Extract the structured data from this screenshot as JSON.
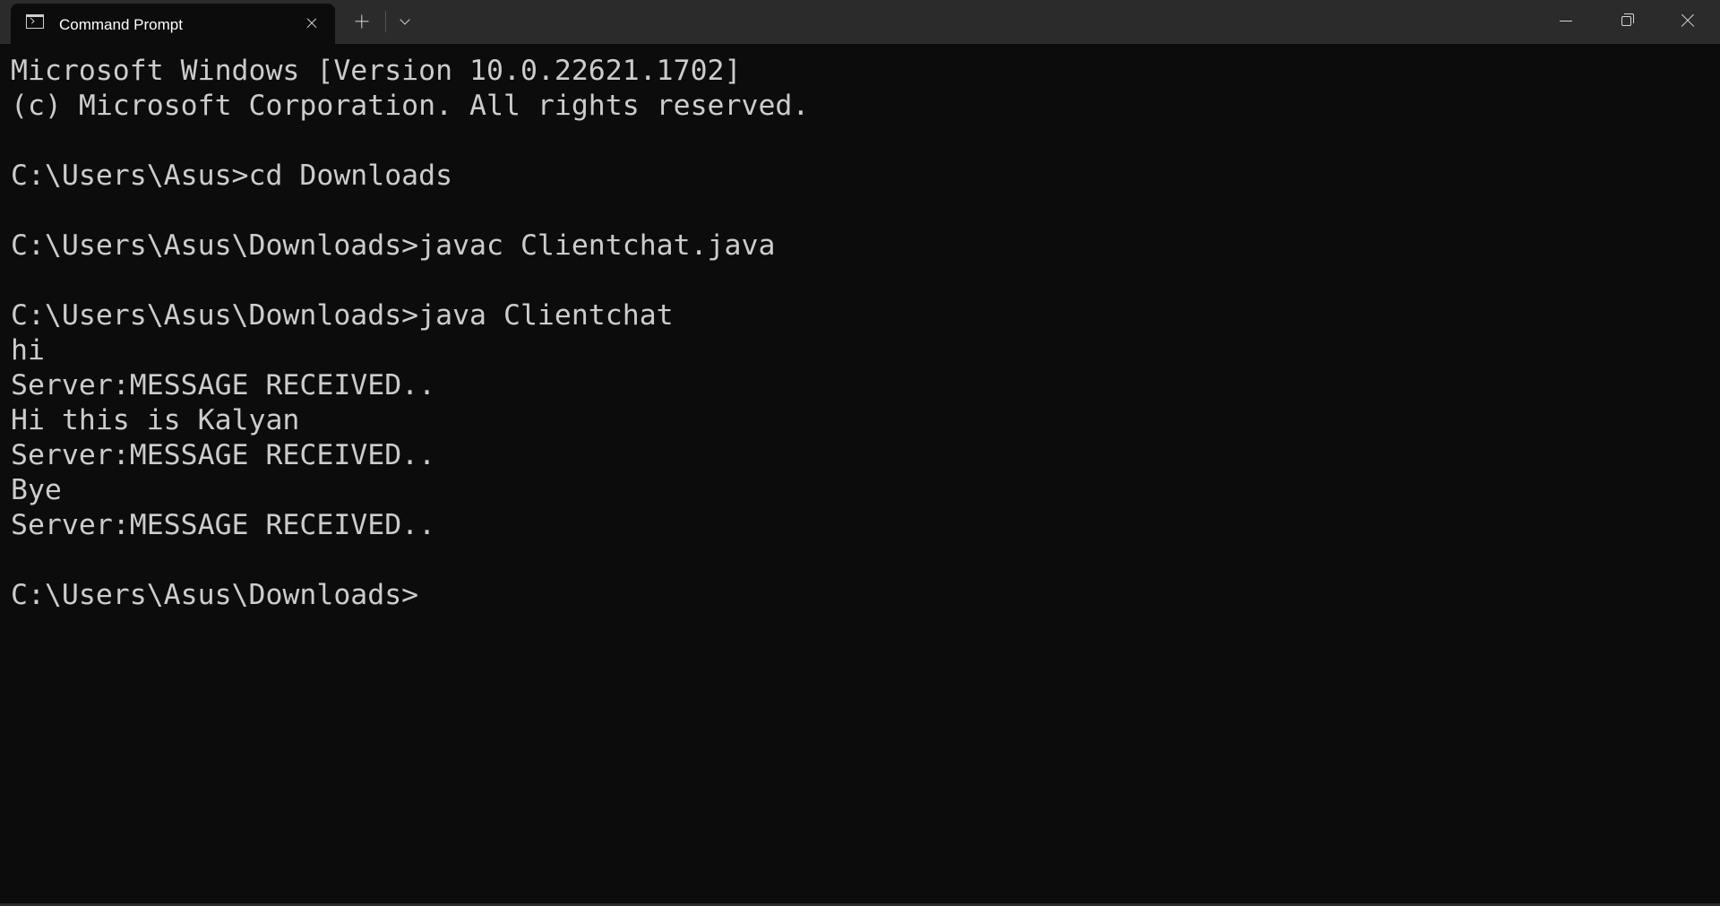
{
  "titlebar": {
    "tab_title": "Command Prompt",
    "tab_icon": "terminal-icon",
    "close_tab_icon": "close-icon",
    "new_tab_icon": "plus-icon",
    "dropdown_icon": "chevron-down-icon"
  },
  "window_controls": {
    "minimize_icon": "minimize-icon",
    "maximize_icon": "restore-icon",
    "close_icon": "close-icon"
  },
  "console": {
    "lines": [
      "Microsoft Windows [Version 10.0.22621.1702]",
      "(c) Microsoft Corporation. All rights reserved.",
      "",
      "C:\\Users\\Asus>cd Downloads",
      "",
      "C:\\Users\\Asus\\Downloads>javac Clientchat.java",
      "",
      "C:\\Users\\Asus\\Downloads>java Clientchat",
      "hi",
      "Server:MESSAGE RECEIVED..",
      "Hi this is Kalyan",
      "Server:MESSAGE RECEIVED..",
      "Bye",
      "Server:MESSAGE RECEIVED..",
      "",
      "C:\\Users\\Asus\\Downloads>"
    ]
  },
  "colors": {
    "background": "#0c0c0c",
    "titlebar": "#2b2b2b",
    "text": "#cccccc"
  }
}
